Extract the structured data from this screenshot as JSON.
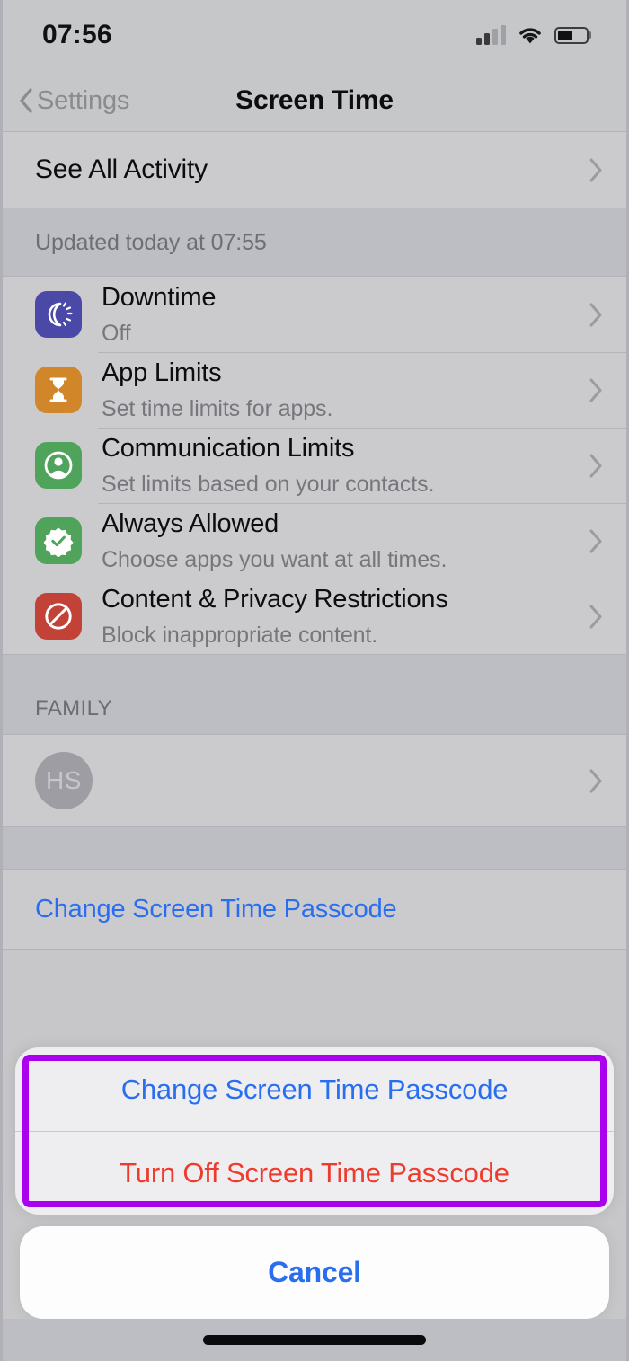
{
  "status_bar": {
    "time": "07:56",
    "signal_icon": "cellular-signal-icon",
    "signal_bars_filled": 2,
    "signal_bars_total": 4,
    "wifi_icon": "wifi-icon",
    "battery_icon": "battery-icon",
    "battery_level_percent": 52
  },
  "nav_bar": {
    "back_label": "Settings",
    "back_icon": "chevron-left-icon",
    "title": "Screen Time"
  },
  "activity": {
    "see_all_label": "See All Activity",
    "chevron_icon": "chevron-right-icon",
    "footnote": "Updated today at 07:55"
  },
  "settings_rows": [
    {
      "title": "Downtime",
      "subtitle": "Off",
      "icon": "downtime-moon-icon",
      "icon_color": "#4a49a8"
    },
    {
      "title": "App Limits",
      "subtitle": "Set time limits for apps.",
      "icon": "hourglass-icon",
      "icon_color": "#d1862a"
    },
    {
      "title": "Communication Limits",
      "subtitle": "Set limits based on your contacts.",
      "icon": "person-circle-icon",
      "icon_color": "#4fa35b"
    },
    {
      "title": "Always Allowed",
      "subtitle": "Choose apps you want at all times.",
      "icon": "checkmark-seal-icon",
      "icon_color": "#4fa35b"
    },
    {
      "title": "Content & Privacy Restrictions",
      "subtitle": "Block inappropriate content.",
      "icon": "no-entry-icon",
      "icon_color": "#c24238"
    }
  ],
  "family": {
    "section_header": "FAMILY",
    "member_initials": "HS",
    "chevron_icon": "chevron-right-icon"
  },
  "passcode": {
    "change_label": "Change Screen Time Passcode"
  },
  "action_sheet": {
    "buttons": [
      {
        "label": "Change Screen Time Passcode",
        "style": "blue"
      },
      {
        "label": "Turn Off Screen Time Passcode",
        "style": "red"
      }
    ],
    "cancel_label": "Cancel",
    "highlight_color": "#aa00ee"
  },
  "colors": {
    "tint_blue": "#2a6ef0",
    "destructive_red": "#ef3b2d",
    "highlight_purple": "#aa00ee",
    "page_background": "#bdbdc4",
    "group_background": "#cbcbcd"
  }
}
